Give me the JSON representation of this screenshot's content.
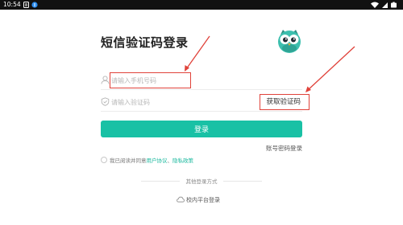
{
  "status_bar": {
    "time": "10:54",
    "icons_left": [
      "notification-icon",
      "app-badge-icon"
    ],
    "icons_right": [
      "wifi-icon",
      "signal-icon",
      "battery-icon"
    ]
  },
  "login": {
    "title": "短信验证码登录",
    "phone": {
      "placeholder": "请输入手机号码",
      "value": "",
      "icon": "user-icon"
    },
    "code": {
      "placeholder": "请输入验证码",
      "value": "",
      "icon": "shield-icon",
      "get_code_label": "获取验证码"
    },
    "login_button_label": "登录",
    "password_login_label": "账号密码登录",
    "agreement": {
      "prefix": "我已阅读并同意",
      "user_agreement": "用户协议",
      "separator": "、",
      "privacy_policy": "隐私政策"
    },
    "other_methods_label": "其他登录方式",
    "campus_login_label": "校内平台登录"
  },
  "colors": {
    "accent": "#19c1a5",
    "link": "#19b89d",
    "annotation": "#e0423a",
    "status_bar": "#111111"
  }
}
